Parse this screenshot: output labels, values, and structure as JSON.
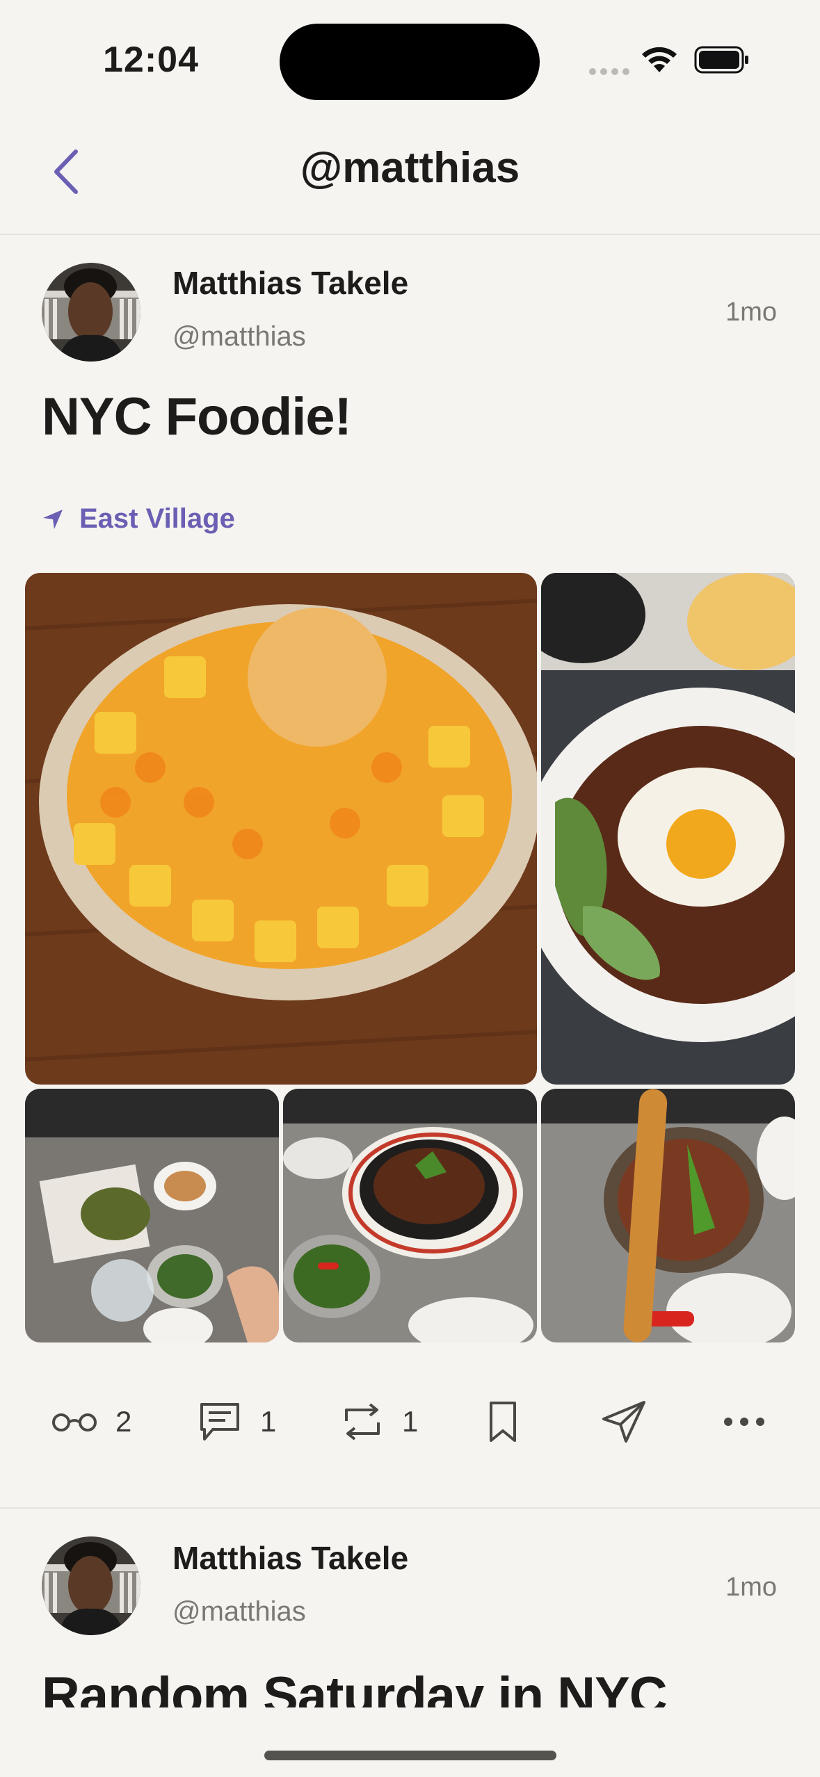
{
  "status_bar": {
    "time": "12:04"
  },
  "nav": {
    "title": "@matthias",
    "back_icon": "chevron-left-icon"
  },
  "colors": {
    "accent": "#6a5fb3",
    "background": "#f6f4f1",
    "text": "#1d1c1b",
    "secondary_text": "#7b7773"
  },
  "posts": [
    {
      "author_name": "Matthias Takele",
      "author_handle": "@matthias",
      "time": "1mo",
      "title": "NYC Foodie!",
      "location": "East Village",
      "photos": [
        "mango-shaved-ice",
        "noodles-with-egg",
        "table-spread",
        "stir-fry-skillet",
        "youtiao-soup"
      ],
      "actions": {
        "views_count": "2",
        "comments_count": "1",
        "reposts_count": "1"
      }
    },
    {
      "author_name": "Matthias Takele",
      "author_handle": "@matthias",
      "time": "1mo",
      "title": "Random Saturday in NYC"
    }
  ]
}
